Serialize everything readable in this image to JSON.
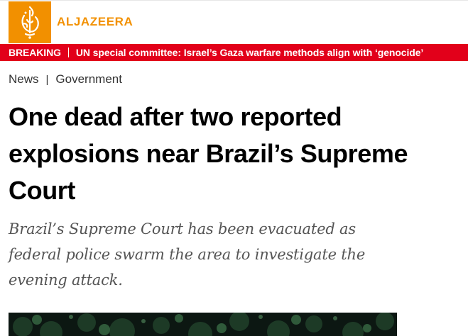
{
  "brand": {
    "name": "ALJAZEERA",
    "logo_color": "#f29000",
    "logo_icon": "aljazeera-calligraphy-icon"
  },
  "breaking": {
    "label": "BREAKING",
    "headline": "UN special committee: Israel’s Gaza warfare methods align with ‘genocide’",
    "background": "#e2001a"
  },
  "breadcrumb": {
    "items": [
      "News",
      "Government"
    ],
    "separator": "|"
  },
  "article": {
    "headline": "One dead after two reported explosions near Brazil’s Supreme Court",
    "standfirst": "Brazil’s Supreme Court has been evacuated as federal police swarm the area to investigate the evening attack."
  },
  "hero_image": {
    "description_icon": "hero-photo"
  }
}
